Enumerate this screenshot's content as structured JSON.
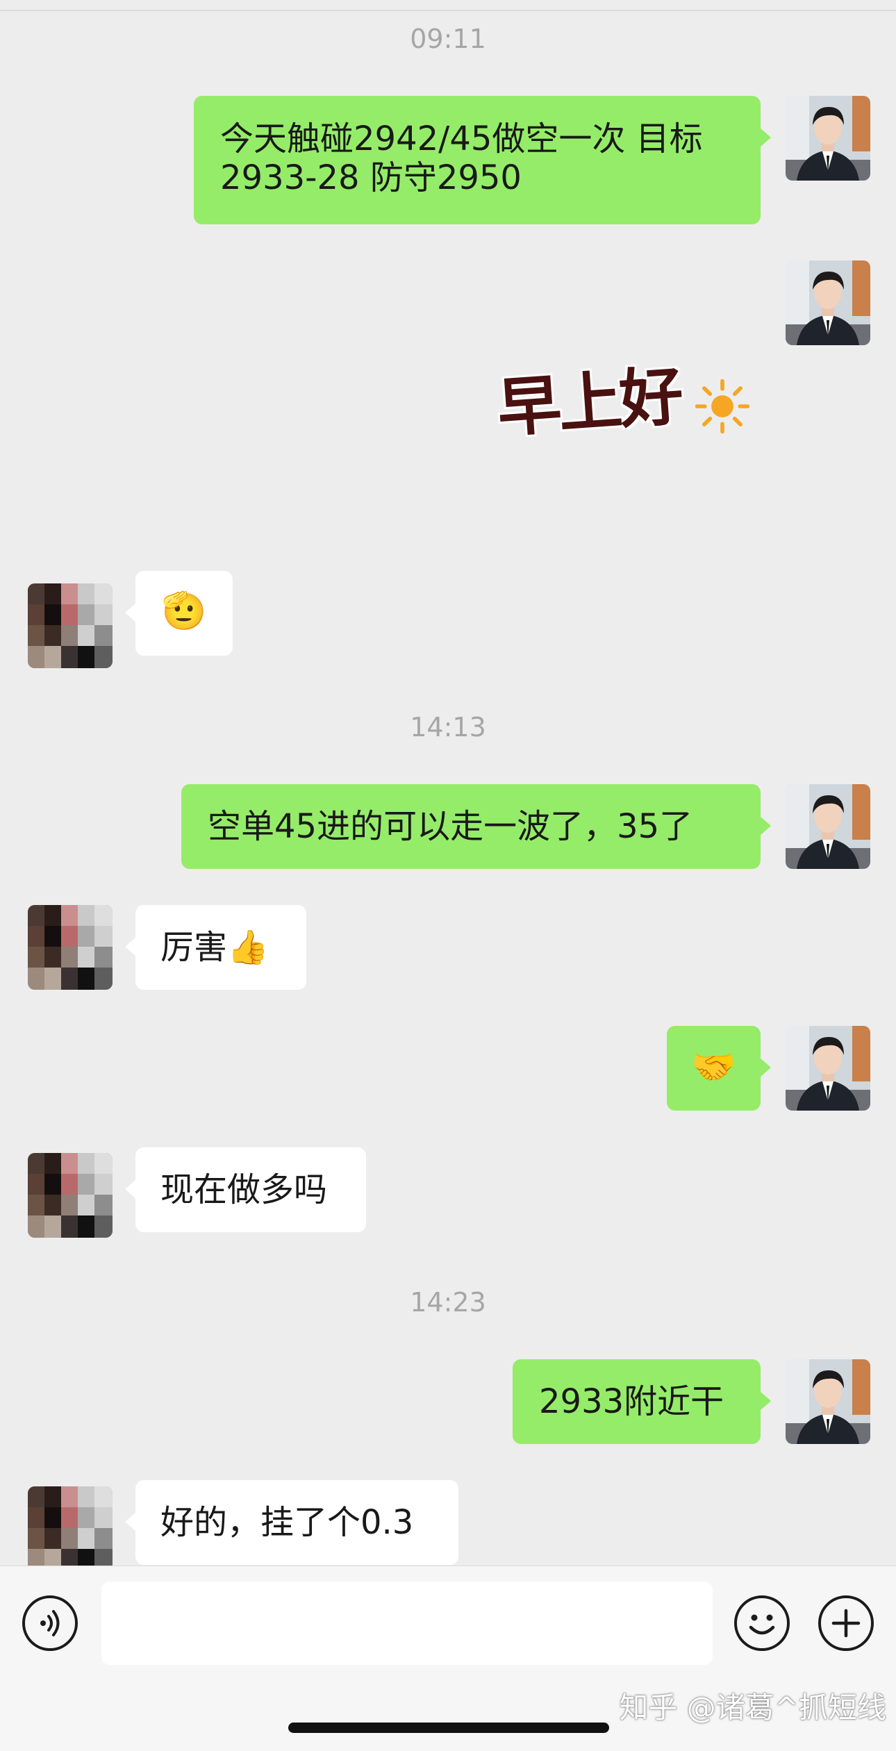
{
  "timestamps": [
    "09:11",
    "14:13",
    "14:23"
  ],
  "messages": {
    "m1": {
      "text_line1": "今天触碰2942/45做空一次 目标",
      "text_line2": "2933-28  防守2950"
    },
    "m2": {
      "sticker_text": "早上好"
    },
    "m3": {
      "emoji": "🫡"
    },
    "m4": {
      "text": "空单45进的可以走一波了，35了"
    },
    "m5": {
      "text": "厉害👍"
    },
    "m6": {
      "emoji": "🤝"
    },
    "m7": {
      "text": "现在做多吗"
    },
    "m8": {
      "text": "2933附近干"
    },
    "m9": {
      "text": "好的，挂了个0.3"
    }
  },
  "input_bar": {
    "voice_icon": "voice-icon",
    "emoji_icon": "emoji-smile-icon",
    "plus_icon": "plus-icon",
    "input_value": ""
  },
  "watermark": "知乎 @诸葛^抓短线",
  "colors": {
    "background": "#ededed",
    "sent_bubble": "#95ec69",
    "received_bubble": "#ffffff",
    "timestamp": "#a6a6a6"
  }
}
